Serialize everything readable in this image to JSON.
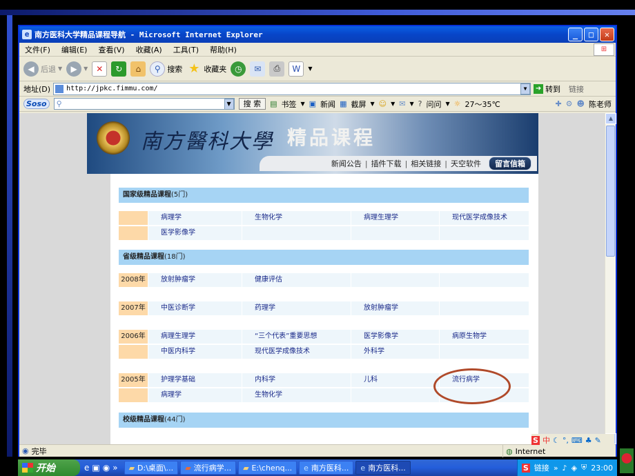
{
  "window": {
    "title": "南方医科大学精品课程导航 - Microsoft Internet Explorer",
    "min": "_",
    "max": "□",
    "close": "✕"
  },
  "menu": [
    "文件(F)",
    "编辑(E)",
    "查看(V)",
    "收藏(A)",
    "工具(T)",
    "帮助(H)"
  ],
  "toolbar": {
    "back": "后退",
    "search": "搜索",
    "favorites": "收藏夹"
  },
  "address": {
    "label": "地址(D)",
    "url": "http://jpkc.fimmu.com/",
    "go": "转到",
    "links": "链接"
  },
  "soso": {
    "logo": "Soso",
    "search_btn": "搜 索",
    "bookmark": "书签",
    "news": "新闻",
    "screenshot": "截屏",
    "ask": "问问",
    "weather": "27～35℃",
    "user": "陈老师"
  },
  "site": {
    "university": "南方醫科大學",
    "title": "精品课程",
    "nav": [
      "新闻公告",
      "插件下载",
      "相关链接",
      "天空软件"
    ],
    "message": "留言信箱"
  },
  "sections": {
    "national": "国家级精品课程",
    "national_count": "(5门)",
    "provincial": "省级精品课程",
    "provincial_count": "(18门)",
    "school": "校级精品课程",
    "school_count": "(44门)"
  },
  "national_rows": [
    [
      "",
      "病理学",
      "生物化学",
      "病理生理学",
      "现代医学成像技术"
    ],
    [
      "",
      "医学影像学",
      "",
      "",
      ""
    ]
  ],
  "provincial_rows": [
    [
      "2008年",
      "放射肿瘤学",
      "健康评估",
      "",
      ""
    ],
    [
      "2007年",
      "中医诊断学",
      "药理学",
      "放射肿瘤学",
      ""
    ],
    [
      "2006年",
      "病理生理学",
      "“三个代表”重要思想",
      "医学影像学",
      "病原生物学"
    ],
    [
      "",
      "中医内科学",
      "现代医学成像技术",
      "外科学",
      ""
    ],
    [
      "2005年",
      "护理学基础",
      "内科学",
      "儿科",
      "流行病学"
    ],
    [
      "",
      "病理学",
      "生物化学",
      "",
      ""
    ]
  ],
  "status": {
    "done": "完毕",
    "zone": "Internet"
  },
  "taskbar": {
    "start": "开始",
    "tasks": [
      "D:\\桌面\\...",
      "流行病学...",
      "E:\\chenq...",
      "南方医科...",
      "南方医科..."
    ],
    "links": "链接",
    "clock": "23:00"
  },
  "colors": {
    "section_bg": "#a6d4f4",
    "year_bg": "#fdd9a8",
    "highlight_circle": "#b04a2a"
  }
}
